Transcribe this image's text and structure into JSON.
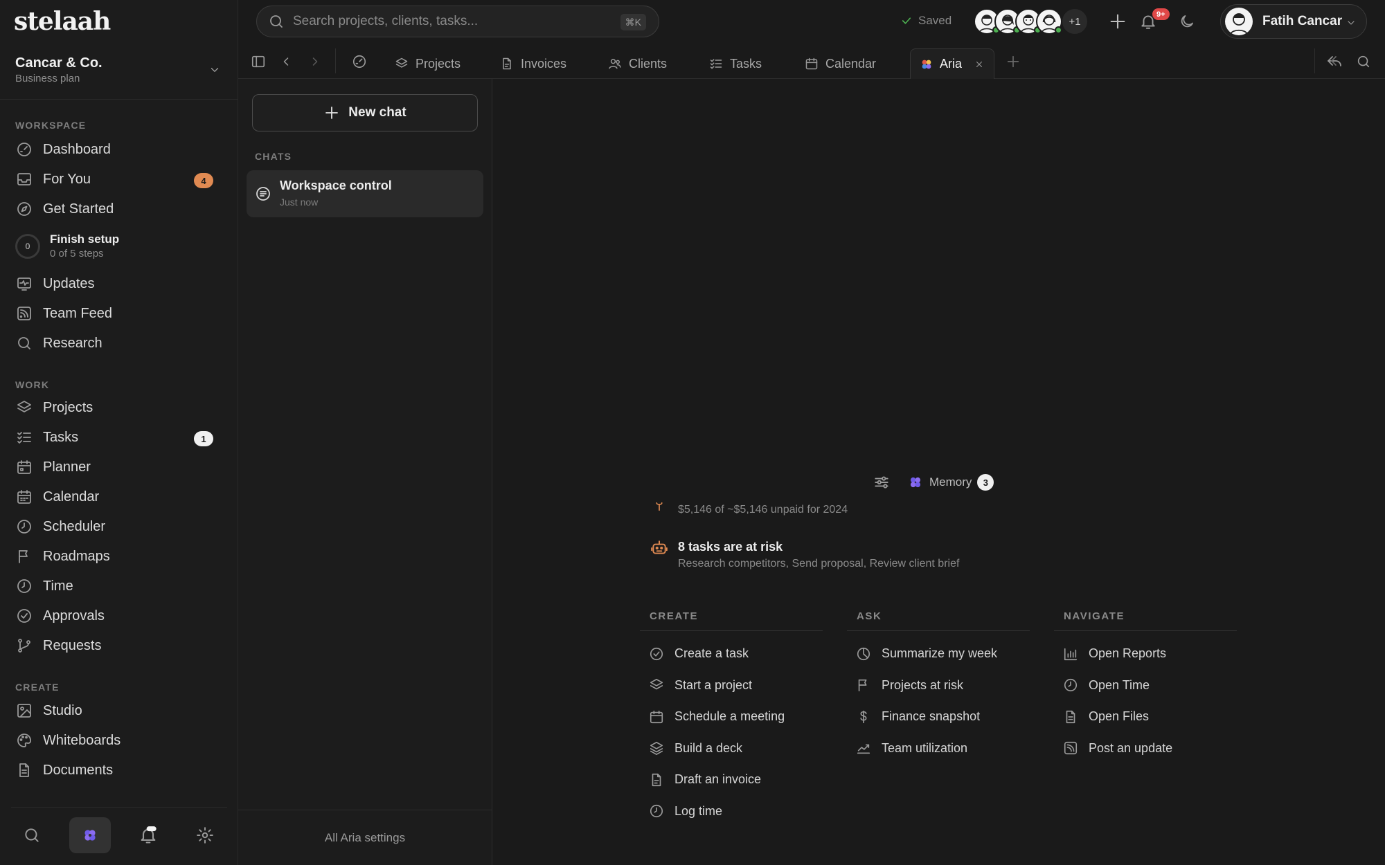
{
  "brand": {
    "logo_text": "stelaah"
  },
  "workspace": {
    "name": "Cancar & Co.",
    "plan": "Business plan"
  },
  "sidebar": {
    "sections": {
      "workspace": "WORKSPACE",
      "work": "WORK",
      "create": "CREATE"
    },
    "items": {
      "dashboard": "Dashboard",
      "for_you": "For You",
      "for_you_badge": "4",
      "get_started": "Get Started",
      "updates": "Updates",
      "team_feed": "Team Feed",
      "research": "Research",
      "projects": "Projects",
      "tasks": "Tasks",
      "tasks_badge": "1",
      "planner": "Planner",
      "calendar": "Calendar",
      "scheduler": "Scheduler",
      "roadmaps": "Roadmaps",
      "time": "Time",
      "approvals": "Approvals",
      "requests": "Requests",
      "studio": "Studio",
      "whiteboards": "Whiteboards",
      "documents": "Documents"
    },
    "finish_setup": {
      "title": "Finish setup",
      "progress_text": "0 of 5 steps",
      "ring_value": "0",
      "completed": 0,
      "total": 5
    }
  },
  "topbar": {
    "search_placeholder": "Search projects, clients, tasks...",
    "search_shortcut": "⌘K",
    "saved_status": "Saved",
    "avatars_more": "+1",
    "notifications_badge": "9+",
    "user_name": "Fatih Cancar"
  },
  "tabs": {
    "projects": "Projects",
    "invoices": "Invoices",
    "clients": "Clients",
    "tasks": "Tasks",
    "calendar": "Calendar",
    "aria": "Aria"
  },
  "chats_panel": {
    "new_chat_label": "New chat",
    "section_label": "CHATS",
    "chats": [
      {
        "title": "Workspace control",
        "time": "Just now"
      }
    ],
    "settings_label": "All Aria settings"
  },
  "main": {
    "memory_label": "Memory",
    "memory_count": "3",
    "insights": {
      "unpaid_sub": "$5,146 of ~$5,146 unpaid for 2024",
      "risk_title": "8 tasks are at risk",
      "risk_sub": "Research competitors, Send proposal, Review client brief"
    },
    "quick_actions": {
      "create": {
        "heading": "CREATE",
        "items": [
          "Create a task",
          "Start a project",
          "Schedule a meeting",
          "Build a deck",
          "Draft an invoice",
          "Log time"
        ]
      },
      "ask": {
        "heading": "ASK",
        "items": [
          "Summarize my week",
          "Projects at risk",
          "Finance snapshot",
          "Team utilization"
        ]
      },
      "navigate": {
        "heading": "NAVIGATE",
        "items": [
          "Open Reports",
          "Open Time",
          "Open Files",
          "Post an update"
        ]
      }
    }
  },
  "colors": {
    "background": "#1a1a1a",
    "badge_orange": "#e08a52",
    "online_green": "#4caf50",
    "notification_red": "#e04848",
    "aria_purple": "#8b6cf0"
  }
}
